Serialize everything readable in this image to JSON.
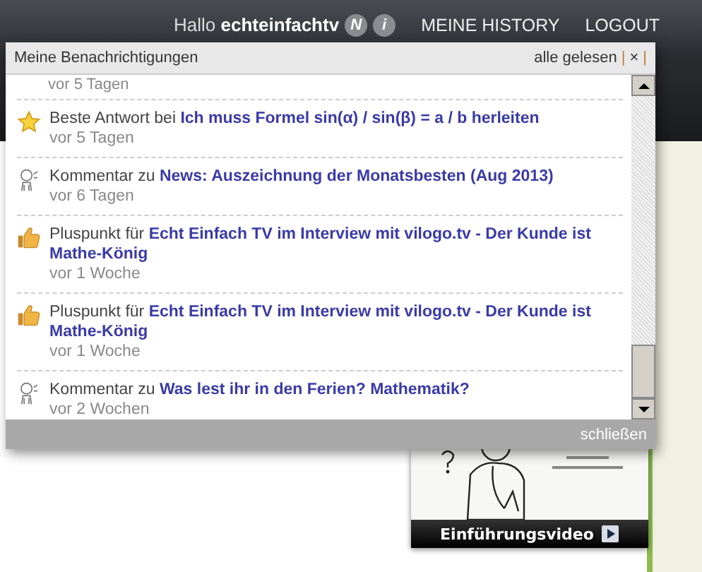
{
  "header": {
    "greeting": "Hallo",
    "username": "echteinfachtv",
    "badges": [
      "N",
      "i"
    ],
    "nav": [
      "MEINE HISTORY",
      "LOGOUT"
    ]
  },
  "notifications": {
    "title": "Meine Benachrichtigungen",
    "actions": [
      "alle gelesen",
      "|",
      "×",
      "|"
    ],
    "cut_time": "vor 5 Tagen",
    "items": [
      {
        "kind": "star",
        "text": "Beste Antwort bei",
        "link": "Ich muss Formel sin(α) / sin(β) = a / b herleiten",
        "time": "vor 5 Tagen"
      },
      {
        "kind": "comment",
        "text": "Kommentar zu",
        "link": "News: Auszeichnung der Monatsbesten (Aug 2013)",
        "time": "vor 6 Tagen"
      },
      {
        "kind": "thumb",
        "text": "Pluspunkt für",
        "link": "Echt Einfach TV im Interview mit vilogo.tv - Der Kunde ist Mathe-König",
        "time": "vor 1 Woche"
      },
      {
        "kind": "thumb",
        "text": "Pluspunkt für",
        "link": "Echt Einfach TV im Interview mit vilogo.tv - Der Kunde ist Mathe-König",
        "time": "vor 1 Woche"
      },
      {
        "kind": "comment",
        "text": "Kommentar zu",
        "link": "Was lest ihr in den Ferien? Mathematik?",
        "time": "vor 2 Wochen"
      }
    ],
    "close": "schließen"
  },
  "video": {
    "kind": "picture",
    "button": "Einführungsvideo"
  }
}
